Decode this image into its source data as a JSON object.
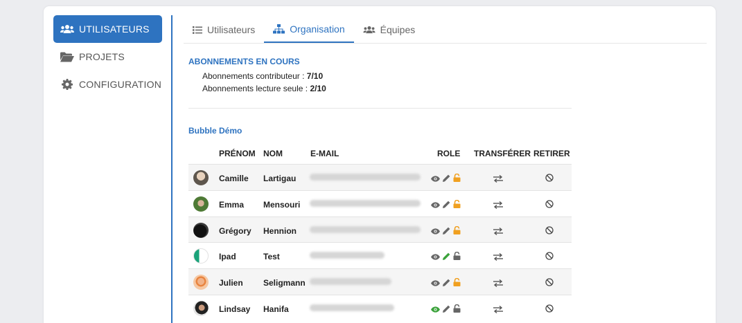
{
  "sidebar": {
    "items": [
      {
        "label": "UTILISATEURS",
        "icon": "users-icon",
        "active": true
      },
      {
        "label": "PROJETS",
        "icon": "folder-open-icon",
        "active": false
      },
      {
        "label": "CONFIGURATION",
        "icon": "gear-icon",
        "active": false
      }
    ]
  },
  "tabs": [
    {
      "label": "Utilisateurs",
      "icon": "list-icon",
      "active": false
    },
    {
      "label": "Organisation",
      "icon": "sitemap-icon",
      "active": true
    },
    {
      "label": "Équipes",
      "icon": "team-icon",
      "active": false
    }
  ],
  "subscriptions": {
    "title": "ABONNEMENTS EN COURS",
    "contributor_label": "Abonnements contributeur : ",
    "contributor_value": "7/10",
    "readonly_label": "Abonnements lecture seule : ",
    "readonly_value": "2/10"
  },
  "organization": {
    "name": "Bubble Démo"
  },
  "table": {
    "headers": {
      "firstname": "PRÉNOM",
      "lastname": "NOM",
      "email": "E-MAIL",
      "role": "ROLE",
      "transfer": "TRANSFÉRER",
      "remove": "RETIRER"
    },
    "rows": [
      {
        "firstname": "Camille",
        "lastname": "Lartigau",
        "email_blurred": true,
        "role": "admin",
        "avatar": "portrait-photo"
      },
      {
        "firstname": "Emma",
        "lastname": "Mensouri",
        "email_blurred": true,
        "role": "admin",
        "avatar": "outdoor-photo"
      },
      {
        "firstname": "Grégory",
        "lastname": "Hennion",
        "email_blurred": true,
        "role": "admin",
        "avatar": "dark-object-photo"
      },
      {
        "firstname": "Ipad",
        "lastname": "Test",
        "email_blurred": true,
        "role": "contributor",
        "avatar": "flag-avatar"
      },
      {
        "firstname": "Julien",
        "lastname": "Seligmann",
        "email_blurred": true,
        "role": "admin",
        "avatar": "cartoon-avatar"
      },
      {
        "firstname": "Lindsay",
        "lastname": "Hanifa",
        "email_blurred": true,
        "role": "reader",
        "avatar": "portrait-photo"
      }
    ]
  },
  "colors": {
    "accent": "#2e73c0",
    "role_active_green": "#3aa23a",
    "role_admin_orange": "#f0a020",
    "role_inactive_gray": "#666666"
  }
}
